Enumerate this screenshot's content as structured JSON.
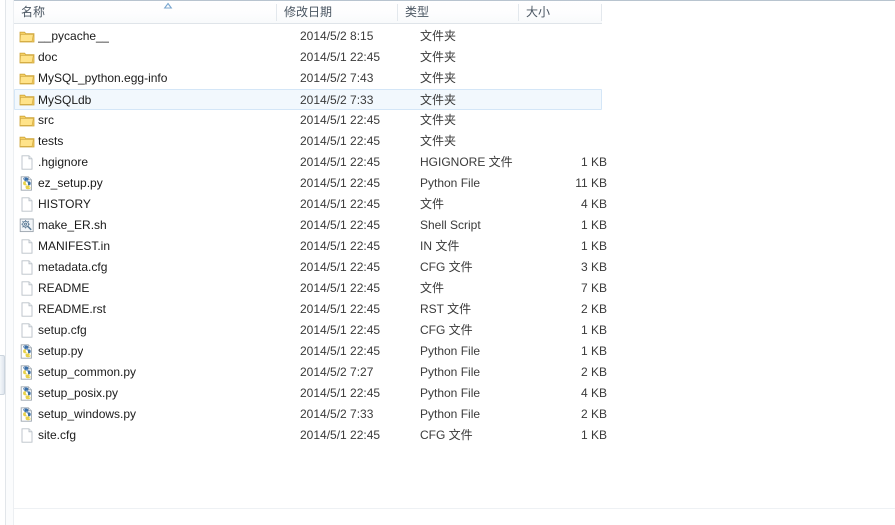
{
  "window": {
    "kind": "windows-explorer-details-view"
  },
  "colors": {
    "selection_fill": "#f2f8fd",
    "selection_border": "#d4e6f7",
    "header_text": "#4a5662",
    "row_text": "#1b1b1b",
    "folder_icon": "#ffd24d",
    "python_icon_blue": "#3a6fa8",
    "python_icon_yellow": "#e8d24a"
  },
  "columns": [
    {
      "key": "name",
      "label": "名称",
      "sorted": true,
      "sort_direction": "ascending"
    },
    {
      "key": "date",
      "label": "修改日期",
      "sorted": false,
      "sort_direction": ""
    },
    {
      "key": "type",
      "label": "类型",
      "sorted": false,
      "sort_direction": ""
    },
    {
      "key": "size",
      "label": "大小",
      "sorted": false,
      "sort_direction": ""
    }
  ],
  "icons": {
    "sort_ascending": "caret-up-icon",
    "folder": "folder-icon",
    "generic_file": "blank-document-icon",
    "python_file": "python-file-icon",
    "shell_script": "shell-script-icon"
  },
  "files": [
    {
      "name": "__pycache__",
      "date": "2014/5/2 8:15",
      "type": "文件夹",
      "size": "",
      "icon": "folder",
      "selected": false
    },
    {
      "name": "doc",
      "date": "2014/5/1 22:45",
      "type": "文件夹",
      "size": "",
      "icon": "folder",
      "selected": false
    },
    {
      "name": "MySQL_python.egg-info",
      "date": "2014/5/2 7:43",
      "type": "文件夹",
      "size": "",
      "icon": "folder",
      "selected": false
    },
    {
      "name": "MySQLdb",
      "date": "2014/5/2 7:33",
      "type": "文件夹",
      "size": "",
      "icon": "folder",
      "selected": true
    },
    {
      "name": "src",
      "date": "2014/5/1 22:45",
      "type": "文件夹",
      "size": "",
      "icon": "folder",
      "selected": false
    },
    {
      "name": "tests",
      "date": "2014/5/1 22:45",
      "type": "文件夹",
      "size": "",
      "icon": "folder",
      "selected": false
    },
    {
      "name": ".hgignore",
      "date": "2014/5/1 22:45",
      "type": "HGIGNORE 文件",
      "size": "1 KB",
      "icon": "generic_file",
      "selected": false
    },
    {
      "name": "ez_setup.py",
      "date": "2014/5/1 22:45",
      "type": "Python File",
      "size": "11 KB",
      "icon": "python_file",
      "selected": false
    },
    {
      "name": "HISTORY",
      "date": "2014/5/1 22:45",
      "type": "文件",
      "size": "4 KB",
      "icon": "generic_file",
      "selected": false
    },
    {
      "name": "make_ER.sh",
      "date": "2014/5/1 22:45",
      "type": "Shell Script",
      "size": "1 KB",
      "icon": "shell_script",
      "selected": false
    },
    {
      "name": "MANIFEST.in",
      "date": "2014/5/1 22:45",
      "type": "IN 文件",
      "size": "1 KB",
      "icon": "generic_file",
      "selected": false
    },
    {
      "name": "metadata.cfg",
      "date": "2014/5/1 22:45",
      "type": "CFG 文件",
      "size": "3 KB",
      "icon": "generic_file",
      "selected": false
    },
    {
      "name": "README",
      "date": "2014/5/1 22:45",
      "type": "文件",
      "size": "7 KB",
      "icon": "generic_file",
      "selected": false
    },
    {
      "name": "README.rst",
      "date": "2014/5/1 22:45",
      "type": "RST 文件",
      "size": "2 KB",
      "icon": "generic_file",
      "selected": false
    },
    {
      "name": "setup.cfg",
      "date": "2014/5/1 22:45",
      "type": "CFG 文件",
      "size": "1 KB",
      "icon": "generic_file",
      "selected": false
    },
    {
      "name": "setup.py",
      "date": "2014/5/1 22:45",
      "type": "Python File",
      "size": "1 KB",
      "icon": "python_file",
      "selected": false
    },
    {
      "name": "setup_common.py",
      "date": "2014/5/2 7:27",
      "type": "Python File",
      "size": "2 KB",
      "icon": "python_file",
      "selected": false
    },
    {
      "name": "setup_posix.py",
      "date": "2014/5/1 22:45",
      "type": "Python File",
      "size": "4 KB",
      "icon": "python_file",
      "selected": false
    },
    {
      "name": "setup_windows.py",
      "date": "2014/5/2 7:33",
      "type": "Python File",
      "size": "2 KB",
      "icon": "python_file",
      "selected": false
    },
    {
      "name": "site.cfg",
      "date": "2014/5/1 22:45",
      "type": "CFG 文件",
      "size": "1 KB",
      "icon": "generic_file",
      "selected": false
    }
  ]
}
